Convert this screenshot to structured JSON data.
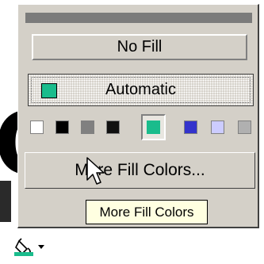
{
  "menu": {
    "no_fill_label": "No Fill",
    "automatic_label": "Automatic",
    "automatic_color": "#1abc8c",
    "more_fill_label": "More Fill Colors..."
  },
  "swatches": [
    {
      "name": "white",
      "color": "#ffffff"
    },
    {
      "name": "black",
      "color": "#000000"
    },
    {
      "name": "gray",
      "color": "#808080"
    },
    {
      "name": "black-2",
      "color": "#101010"
    },
    {
      "name": "teal",
      "color": "#1abc8c",
      "selected": true
    },
    {
      "name": "blue",
      "color": "#3333cc"
    },
    {
      "name": "lavender",
      "color": "#ccccff"
    },
    {
      "name": "silver",
      "color": "#b0b0b0"
    }
  ],
  "tooltip": {
    "text": "More Fill Colors"
  },
  "toolbar": {
    "fill_icon": "paint-bucket-icon",
    "dropdown_icon": "chevron-down-icon",
    "current_color": "#1abc8c"
  },
  "icons": {
    "cursor": "arrow-pointer-icon",
    "mnemonic_letter_hint": "o"
  }
}
